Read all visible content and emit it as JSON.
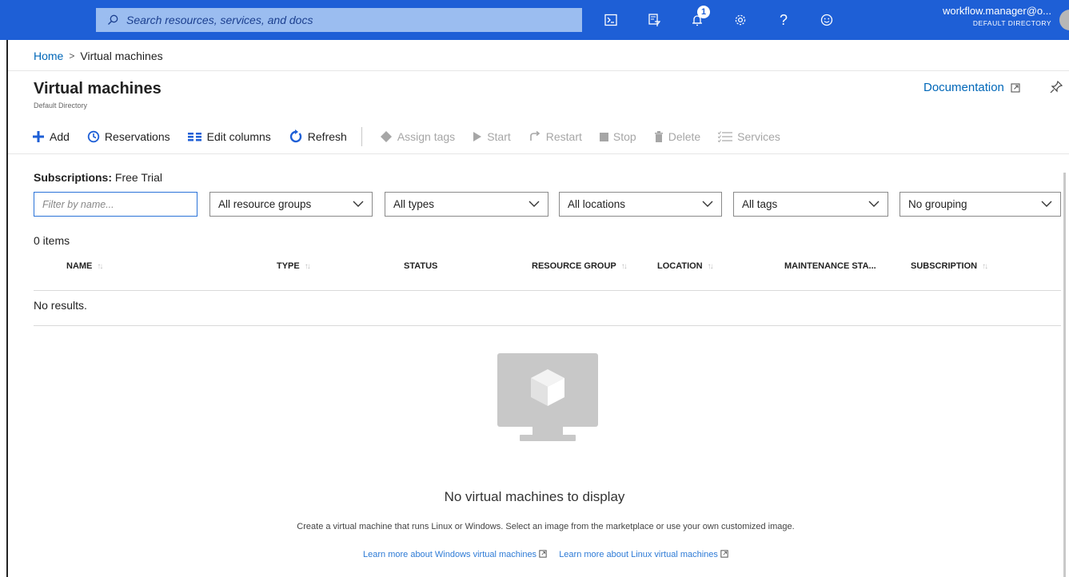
{
  "topbar": {
    "search_placeholder": "Search resources, services, and docs",
    "notification_count": "1",
    "user_email": "workflow.manager@o...",
    "user_directory": "DEFAULT DIRECTORY",
    "icons": [
      "cloud-shell-icon",
      "directory-filter-icon",
      "notifications-icon",
      "settings-icon",
      "help-icon",
      "feedback-icon"
    ]
  },
  "breadcrumb": {
    "home": "Home",
    "separator": ">",
    "current": "Virtual machines"
  },
  "header": {
    "title": "Virtual machines",
    "subtitle": "Default Directory",
    "documentation": "Documentation"
  },
  "toolbar": {
    "add": "Add",
    "reservations": "Reservations",
    "edit_columns": "Edit columns",
    "refresh": "Refresh",
    "assign_tags": "Assign tags",
    "start": "Start",
    "restart": "Restart",
    "stop": "Stop",
    "delete": "Delete",
    "services": "Services"
  },
  "subscriptions": {
    "label": "Subscriptions:",
    "value": "Free Trial"
  },
  "filters": {
    "name_placeholder": "Filter by name...",
    "resource_groups": "All resource groups",
    "types": "All types",
    "locations": "All locations",
    "tags": "All tags",
    "grouping": "No grouping"
  },
  "list": {
    "count": "0 items",
    "columns": [
      "NAME",
      "TYPE",
      "STATUS",
      "RESOURCE GROUP",
      "LOCATION",
      "MAINTENANCE STA...",
      "SUBSCRIPTION"
    ],
    "no_results": "No results."
  },
  "empty_state": {
    "message": "No virtual machines to display",
    "description": "Create a virtual machine that runs Linux or Windows. Select an image from the marketplace or use your own customized image.",
    "link_windows": "Learn more about Windows virtual machines",
    "link_linux": "Learn more about Linux virtual machines"
  },
  "colors": {
    "topbar": "#1e5fd6",
    "link": "#0067b8",
    "accent": "#2b73d8"
  }
}
